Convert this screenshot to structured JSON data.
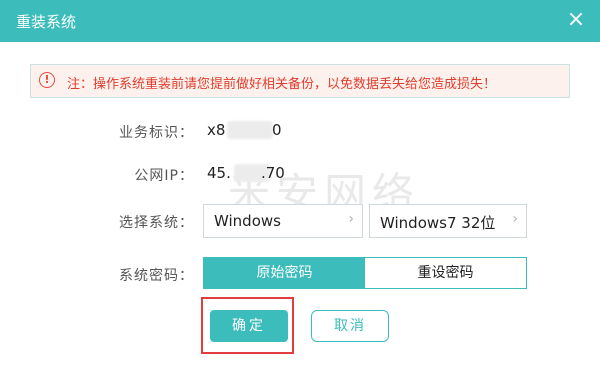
{
  "dialog": {
    "title": "重装系统",
    "close_symbol": "×",
    "accent_color": "#3dbcbc"
  },
  "notice": {
    "icon": "warning-circle-icon",
    "text": "注：操作系统重装前请您提前做好相关备份，以免数据丢失给您造成损失！"
  },
  "fields": {
    "business_id": {
      "label": "业务标识：",
      "value_prefix": "x8",
      "value_suffix": "0"
    },
    "public_ip": {
      "label": "公网IP：",
      "value_prefix": "45.",
      "value_suffix": ".70"
    },
    "system": {
      "label": "选择系统：",
      "os_family": "Windows",
      "os_version": "Windows7 32位"
    },
    "password": {
      "label": "系统密码：",
      "tabs": [
        {
          "label": "原始密码",
          "active": true
        },
        {
          "label": "重设密码",
          "active": false
        }
      ]
    }
  },
  "buttons": {
    "confirm": "确定",
    "cancel": "取消"
  },
  "watermark": "米安网络"
}
